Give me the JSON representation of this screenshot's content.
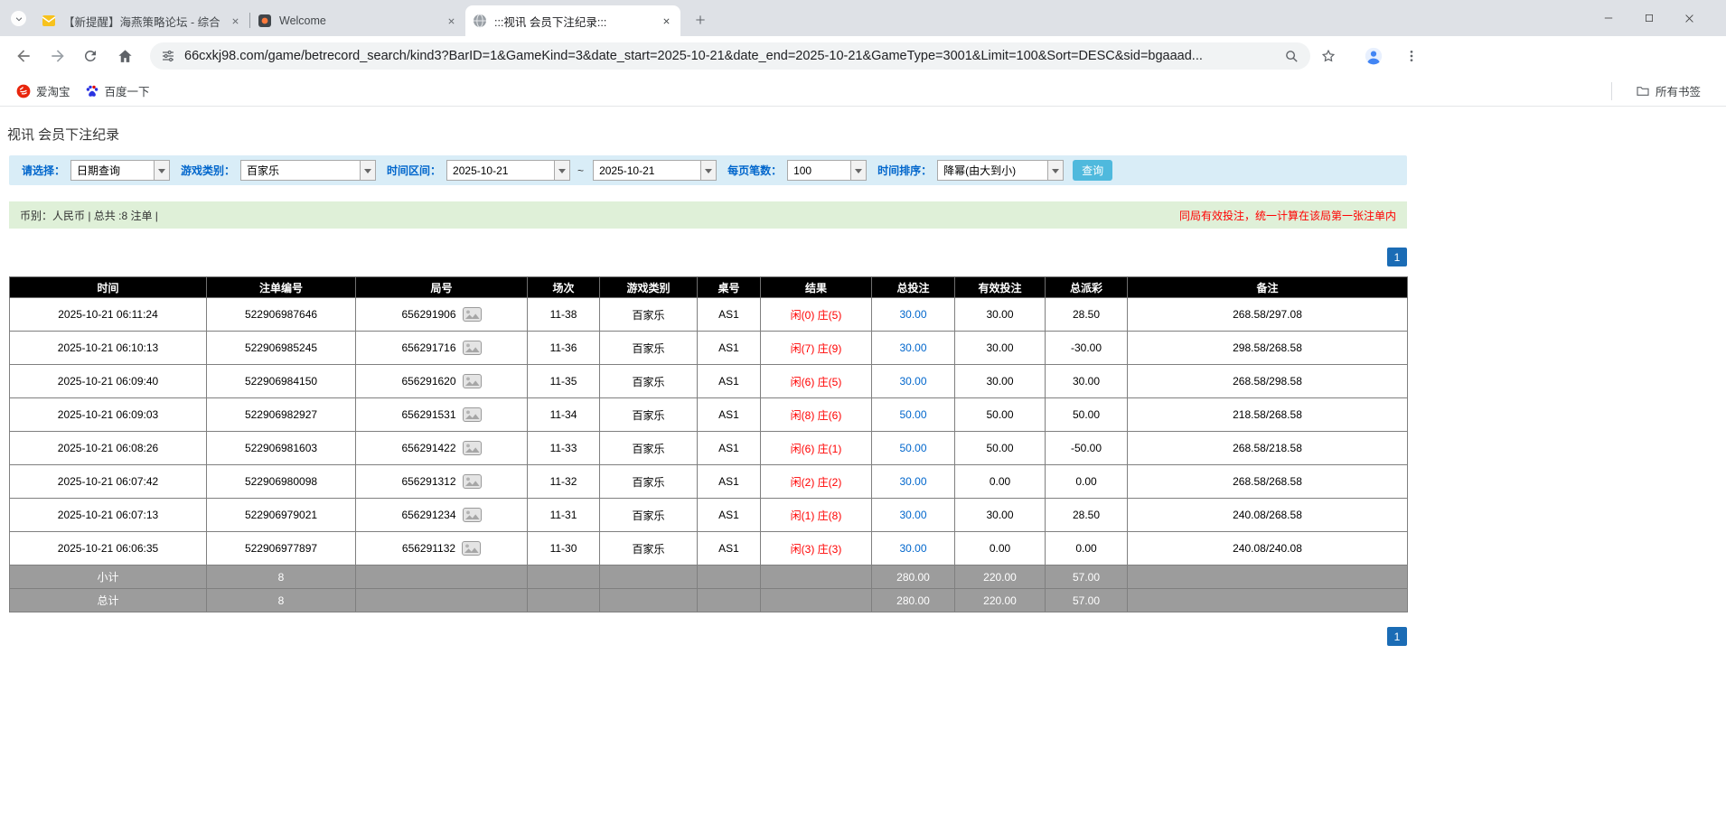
{
  "colors": {
    "accent_blue": "#0066cc",
    "negative_red": "#ff0000",
    "result_red": "#ff0000",
    "filter_bar_bg": "#d9edf7",
    "info_bar_bg": "#dff0d8",
    "table_header_bg": "#000000",
    "sum_row_bg": "#9c9c9c",
    "search_button_bg": "#4fb9dd",
    "pagination_bg": "#1b6cb5"
  },
  "browser": {
    "tabs": [
      {
        "title": "【新提醒】海燕策略论坛 - 综合",
        "active": false
      },
      {
        "title": "Welcome",
        "active": false
      },
      {
        "title": ":::视讯 会员下注纪录:::",
        "active": true
      }
    ],
    "url": "66cxkj98.com/game/betrecord_search/kind3?BarID=1&GameKind=3&date_start=2025-10-21&date_end=2025-10-21&GameType=3001&Limit=100&Sort=DESC&sid=bgaaad...",
    "bookmarks": {
      "items": [
        {
          "label": "爱淘宝"
        },
        {
          "label": "百度一下"
        }
      ],
      "all_label": "所有书签"
    }
  },
  "page": {
    "title": "视讯 会员下注纪录",
    "filters": {
      "query_type": {
        "label": "请选择：",
        "value": "日期查询"
      },
      "game_type": {
        "label": "游戏类别：",
        "value": "百家乐"
      },
      "date_range": {
        "label": "时间区间：",
        "start": "2025-10-21",
        "separator": "~",
        "end": "2025-10-21"
      },
      "page_size": {
        "label": "每页笔数：",
        "value": "100"
      },
      "sort": {
        "label": "时间排序：",
        "value": "降幂(由大到小)"
      },
      "search_button": "查询"
    },
    "info_bar": {
      "left": "币别：人民币 | 总共 :8 注单 |",
      "right": "同局有效投注，统一计算在该局第一张注单内"
    },
    "pagination": {
      "page": "1"
    },
    "table": {
      "headers": [
        "时间",
        "注单编号",
        "局号",
        "场次",
        "游戏类别",
        "桌号",
        "结果",
        "总投注",
        "有效投注",
        "总派彩",
        "备注"
      ],
      "rows": [
        {
          "time": "2025-10-21 06:11:24",
          "bet_id": "522906987646",
          "round_no": "656291906",
          "session": "11-38",
          "game": "百家乐",
          "table_no": "AS1",
          "player": "闲(0)",
          "banker": "庄(5)",
          "total_bet": "30.00",
          "valid_bet": "30.00",
          "payout": "28.50",
          "remark": "268.58/297.08"
        },
        {
          "time": "2025-10-21 06:10:13",
          "bet_id": "522906985245",
          "round_no": "656291716",
          "session": "11-36",
          "game": "百家乐",
          "table_no": "AS1",
          "player": "闲(7)",
          "banker": "庄(9)",
          "total_bet": "30.00",
          "valid_bet": "30.00",
          "payout": "-30.00",
          "remark": "298.58/268.58"
        },
        {
          "time": "2025-10-21 06:09:40",
          "bet_id": "522906984150",
          "round_no": "656291620",
          "session": "11-35",
          "game": "百家乐",
          "table_no": "AS1",
          "player": "闲(6)",
          "banker": "庄(5)",
          "total_bet": "30.00",
          "valid_bet": "30.00",
          "payout": "30.00",
          "remark": "268.58/298.58"
        },
        {
          "time": "2025-10-21 06:09:03",
          "bet_id": "522906982927",
          "round_no": "656291531",
          "session": "11-34",
          "game": "百家乐",
          "table_no": "AS1",
          "player": "闲(8)",
          "banker": "庄(6)",
          "total_bet": "50.00",
          "valid_bet": "50.00",
          "payout": "50.00",
          "remark": "218.58/268.58"
        },
        {
          "time": "2025-10-21 06:08:26",
          "bet_id": "522906981603",
          "round_no": "656291422",
          "session": "11-33",
          "game": "百家乐",
          "table_no": "AS1",
          "player": "闲(6)",
          "banker": "庄(1)",
          "total_bet": "50.00",
          "valid_bet": "50.00",
          "payout": "-50.00",
          "remark": "268.58/218.58"
        },
        {
          "time": "2025-10-21 06:07:42",
          "bet_id": "522906980098",
          "round_no": "656291312",
          "session": "11-32",
          "game": "百家乐",
          "table_no": "AS1",
          "player": "闲(2)",
          "banker": "庄(2)",
          "total_bet": "30.00",
          "valid_bet": "0.00",
          "payout": "0.00",
          "remark": "268.58/268.58"
        },
        {
          "time": "2025-10-21 06:07:13",
          "bet_id": "522906979021",
          "round_no": "656291234",
          "session": "11-31",
          "game": "百家乐",
          "table_no": "AS1",
          "player": "闲(1)",
          "banker": "庄(8)",
          "total_bet": "30.00",
          "valid_bet": "30.00",
          "payout": "28.50",
          "remark": "240.08/268.58"
        },
        {
          "time": "2025-10-21 06:06:35",
          "bet_id": "522906977897",
          "round_no": "656291132",
          "session": "11-30",
          "game": "百家乐",
          "table_no": "AS1",
          "player": "闲(3)",
          "banker": "庄(3)",
          "total_bet": "30.00",
          "valid_bet": "0.00",
          "payout": "0.00",
          "remark": "240.08/240.08"
        }
      ],
      "subtotal": {
        "label": "小计",
        "count": "8",
        "total_bet": "280.00",
        "valid_bet": "220.00",
        "payout": "57.00"
      },
      "total": {
        "label": "总计",
        "count": "8",
        "total_bet": "280.00",
        "valid_bet": "220.00",
        "payout": "57.00"
      }
    }
  }
}
